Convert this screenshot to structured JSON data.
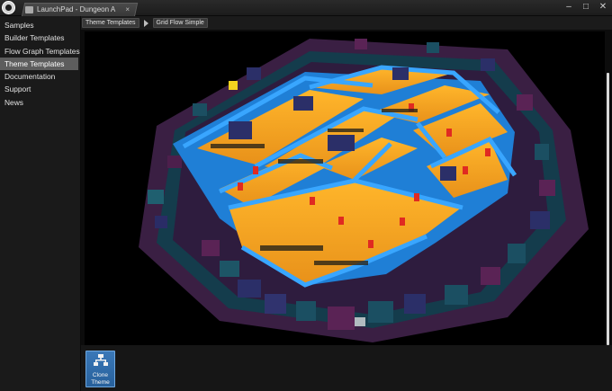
{
  "window": {
    "tab_title": "LaunchPad - Dungeon A",
    "tab_close": "×",
    "controls": {
      "minimize": "–",
      "maximize": "□",
      "close": "✕"
    }
  },
  "sidebar": {
    "items": [
      {
        "label": "Samples"
      },
      {
        "label": "Builder Templates"
      },
      {
        "label": "Flow Graph Templates"
      },
      {
        "label": "Theme Templates",
        "selected": true
      },
      {
        "label": "Documentation"
      },
      {
        "label": "Support"
      },
      {
        "label": "News"
      }
    ]
  },
  "breadcrumb": {
    "items": [
      {
        "label": "Theme Templates"
      },
      {
        "label": "Grid Flow Simple"
      }
    ]
  },
  "preview": {
    "alt": "Grid Flow Simple dungeon theme preview",
    "colors": {
      "floor": "#f2a51f",
      "wall": "#2f8ee0",
      "pillar": "#e02a21",
      "cube_dark": "#2b2f68",
      "cube_teal": "#1b4f62",
      "cube_purple": "#5a2355"
    }
  },
  "actions": {
    "clone_button": {
      "line1": "Clone",
      "line2": "Theme",
      "icon": "hierarchy-icon"
    }
  },
  "colors": {
    "accent": "#2f6aa8",
    "sidebar_selected": "#5d5d5d"
  }
}
